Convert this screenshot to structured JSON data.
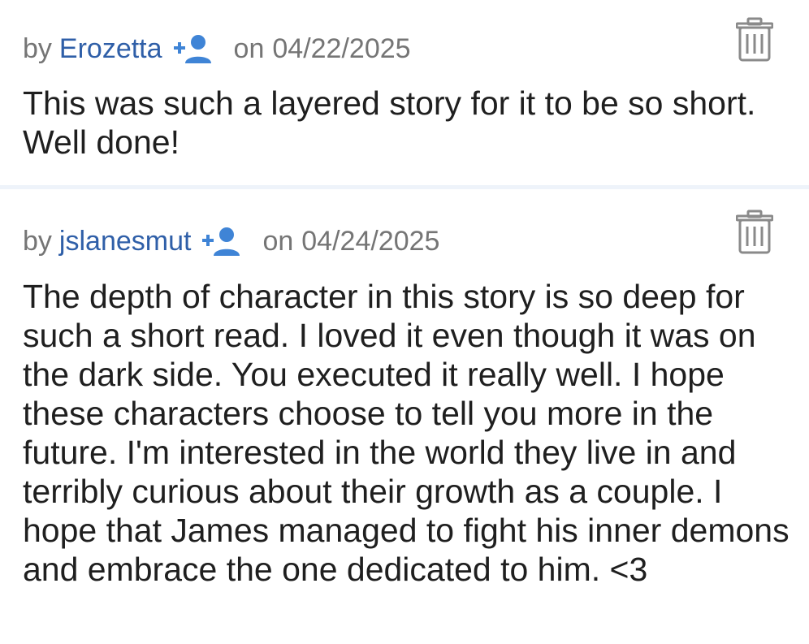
{
  "comments": [
    {
      "by_label": "by",
      "username": "Erozetta",
      "on_label": "on",
      "date": "04/22/2025",
      "text": "This was such a layered story for it to be so short. Well done!"
    },
    {
      "by_label": "by",
      "username": "jslanesmut",
      "on_label": "on",
      "date": "04/24/2025",
      "text": "The depth of character in this story is so deep for such a short read. I loved it even though it was on the dark side. You executed it really well. I hope these characters choose to tell you more in the future. I'm interested in the world they live in and terribly curious about their growth as a couple. I hope that James managed to fight his inner demons and embrace the one dedicated to him. <3"
    }
  ],
  "icons": {
    "follow": "follow-user-icon",
    "delete": "trash-icon"
  },
  "colors": {
    "username": "#2f5fa8",
    "follow_icon": "#3f84d6",
    "meta_text": "#757575",
    "body_text": "#1f1f1f",
    "trash": "#8a8a8a",
    "divider": "#eef3fa"
  }
}
